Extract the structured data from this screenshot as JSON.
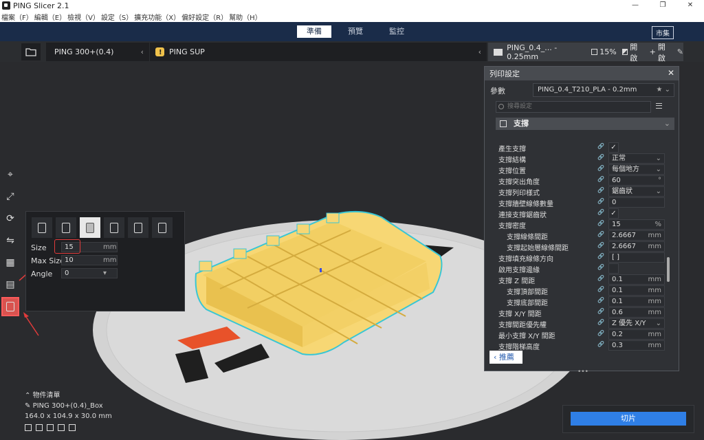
{
  "window": {
    "title": "PING Slicer 2.1",
    "minimize": "—",
    "maximize": "❐",
    "close": "✕"
  },
  "menu": [
    "檔案（F）",
    "編輯（E）",
    "檢視（V）",
    "設定（S）",
    "擴充功能（X）",
    "偏好設定（R）",
    "幫助（H）"
  ],
  "modes": {
    "tabs": [
      "準備",
      "預覽",
      "監控"
    ],
    "active": "準備",
    "shop": "市集"
  },
  "toolbar": {
    "printer": "PING 300+(0.4)",
    "support": "PING SUP",
    "profile": "PING_0.4_... - 0.25mm",
    "infill": "15%",
    "support_state": "開啟",
    "adhesion_state": "開啟"
  },
  "tool_panel": {
    "size_label": "Size",
    "size_value": "15",
    "max_size_label": "Max Size",
    "max_size_value": "10",
    "angle_label": "Angle",
    "angle_value": "0",
    "unit": "mm"
  },
  "object_list": {
    "header": "物件清單",
    "name": "PING 300+(0.4)_Box",
    "dimensions": "164.0 x 104.9 x 30.0 mm"
  },
  "settings": {
    "title": "列印設定",
    "close": "✕",
    "param_label": "參數",
    "param_value": "PING_0.4_T210_PLA - 0.2mm",
    "search_placeholder": "搜尋設定",
    "category": "支撐",
    "rows": [
      {
        "label": "產生支撐",
        "type": "check",
        "value": "✓",
        "indent": false
      },
      {
        "label": "支撐結構",
        "type": "select",
        "value": "正常",
        "indent": false
      },
      {
        "label": "支撐位置",
        "type": "select",
        "value": "每個地方",
        "indent": false
      },
      {
        "label": "支撐突出角度",
        "type": "num",
        "value": "60",
        "unit": "°",
        "indent": false
      },
      {
        "label": "支撐列印樣式",
        "type": "select",
        "value": "鋸齒狀",
        "indent": false
      },
      {
        "label": "支撐牆壁線條數量",
        "type": "num",
        "value": "0",
        "unit": "",
        "indent": false
      },
      {
        "label": "連接支撐鋸齒狀",
        "type": "check",
        "value": "✓",
        "indent": false
      },
      {
        "label": "支撐密度",
        "type": "num",
        "value": "15",
        "unit": "%",
        "indent": false
      },
      {
        "label": "支撐線條間距",
        "type": "num",
        "value": "2.6667",
        "unit": "mm",
        "indent": true
      },
      {
        "label": "支撐起始層線條間距",
        "type": "num",
        "value": "2.6667",
        "unit": "mm",
        "indent": true
      },
      {
        "label": "支撐填充線條方向",
        "type": "num",
        "value": "[ ]",
        "unit": "",
        "indent": false
      },
      {
        "label": "啟用支撐邊緣",
        "type": "check",
        "value": "",
        "indent": false
      },
      {
        "label": "支撐 Z 間距",
        "type": "num",
        "value": "0.1",
        "unit": "mm",
        "indent": false
      },
      {
        "label": "支撐頂部間距",
        "type": "num",
        "value": "0.1",
        "unit": "mm",
        "indent": true
      },
      {
        "label": "支撐底部間距",
        "type": "num",
        "value": "0.1",
        "unit": "mm",
        "indent": true
      },
      {
        "label": "支撐 X/Y 間距",
        "type": "num",
        "value": "0.6",
        "unit": "mm",
        "indent": false
      },
      {
        "label": "支撐間距優先權",
        "type": "select",
        "value": "Z 優先 X/Y",
        "indent": false
      },
      {
        "label": "最小支撐 X/Y 間距",
        "type": "num",
        "value": "0.2",
        "unit": "mm",
        "indent": false
      },
      {
        "label": "支撐階梯高度",
        "type": "num",
        "value": "0.3",
        "unit": "mm",
        "indent": false
      }
    ],
    "recommend": "推薦",
    "more": "•••"
  },
  "slice": {
    "label": "切片"
  },
  "colors": {
    "mode_bar": "#1a2c49",
    "accent": "#2f7fe6",
    "model": "#f7d774",
    "model_outline": "#39c6d4",
    "highlight": "#e23b3b"
  }
}
